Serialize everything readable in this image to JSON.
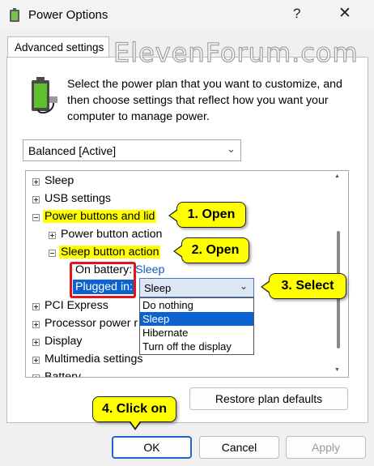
{
  "window": {
    "title": "Power Options",
    "help": "?",
    "close": "✕"
  },
  "tab": {
    "label": "Advanced settings"
  },
  "watermark": "ElevenForum.com",
  "description": "Select the power plan that you want to customize, and then choose settings that reflect how you want your computer to manage power.",
  "plan_select": {
    "value": "Balanced [Active]"
  },
  "tree": {
    "sleep": "Sleep",
    "usb": "USB settings",
    "power_buttons": "Power buttons and lid",
    "power_button_action": "Power button action",
    "sleep_button_action": "Sleep button action",
    "on_battery_label": "On battery:",
    "on_battery_value": "Sleep",
    "plugged_in_label": "Plugged in:",
    "plugged_in_value": "Sleep",
    "pci": "PCI Express",
    "processor": "Processor power r",
    "display": "Display",
    "multimedia": "Multimedia settings",
    "battery": "Battery"
  },
  "dropdown_options": [
    "Do nothing",
    "Sleep",
    "Hibernate",
    "Turn off the display"
  ],
  "callouts": {
    "open1": "1. Open",
    "open2": "2. Open",
    "select3": "3. Select",
    "click4": "4. Click on"
  },
  "buttons": {
    "restore": "Restore plan defaults",
    "ok": "OK",
    "cancel": "Cancel",
    "apply": "Apply"
  },
  "colors": {
    "highlight": "#ffff00",
    "accent": "#0c63cf",
    "red_box": "#e0161a"
  }
}
